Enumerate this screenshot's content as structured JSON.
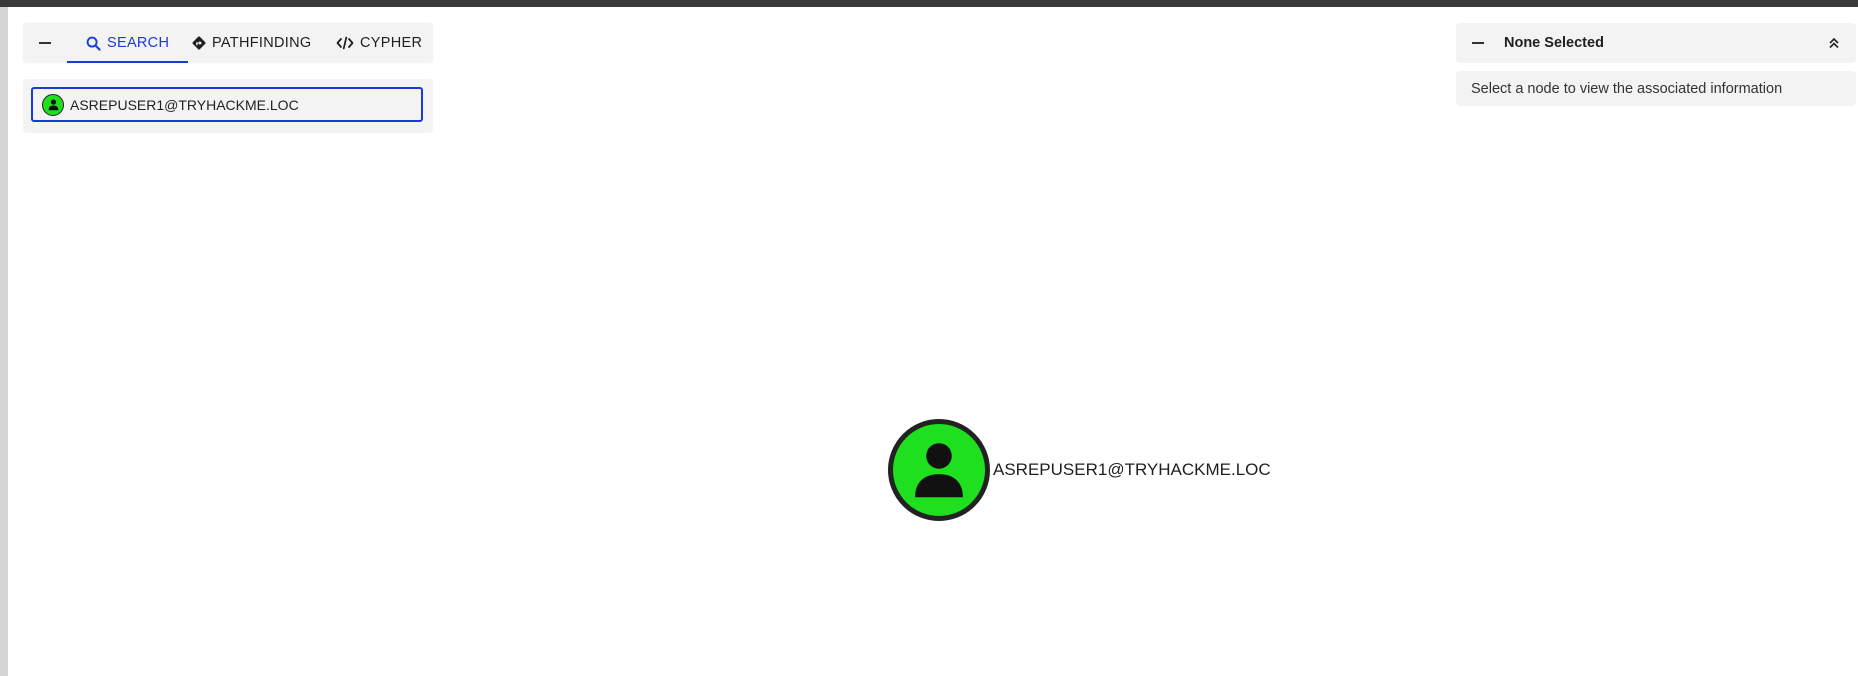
{
  "search_panel": {
    "tabs": [
      {
        "label": "SEARCH",
        "icon": "search-icon",
        "active": true
      },
      {
        "label": "PATHFINDING",
        "icon": "directions-icon",
        "active": false
      },
      {
        "label": "CYPHER",
        "icon": "code-icon",
        "active": false
      }
    ],
    "search": {
      "value": "ASREPUSER1@TRYHACKME.LOC",
      "node_type_icon": "user-icon"
    }
  },
  "info_panel": {
    "title": "None Selected",
    "message": "Select a node to view the associated information"
  },
  "graph": {
    "nodes": [
      {
        "label": "ASREPUSER1@TRYHACKME.LOC",
        "type": "User",
        "icon": "user-icon"
      }
    ]
  },
  "colors": {
    "accent": "#1a3bd8",
    "user_node": "#1ee01e",
    "panel_bg": "#f3f3f3"
  }
}
